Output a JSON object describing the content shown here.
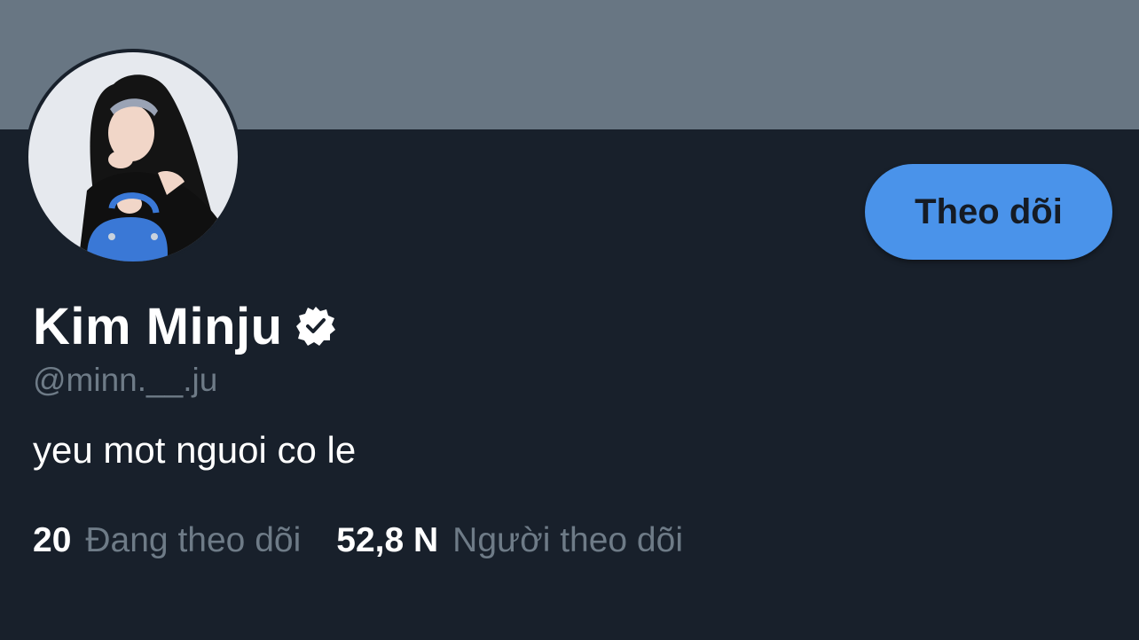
{
  "profile": {
    "display_name": "Kim Minju",
    "handle": "@minn.__.ju",
    "bio": "yeu mot nguoi co le",
    "verified_icon": "verified-badge-icon",
    "avatar_icon": "profile-photo"
  },
  "actions": {
    "follow_label": "Theo dõi"
  },
  "stats": {
    "following_count": "20",
    "following_label": "Đang theo dõi",
    "followers_count": "52,8 N",
    "followers_label": "Người theo dõi"
  },
  "colors": {
    "background": "#18202b",
    "banner": "#687683",
    "accent": "#4a93ea",
    "muted_text": "#6e7b87",
    "primary_text": "#ffffff"
  }
}
